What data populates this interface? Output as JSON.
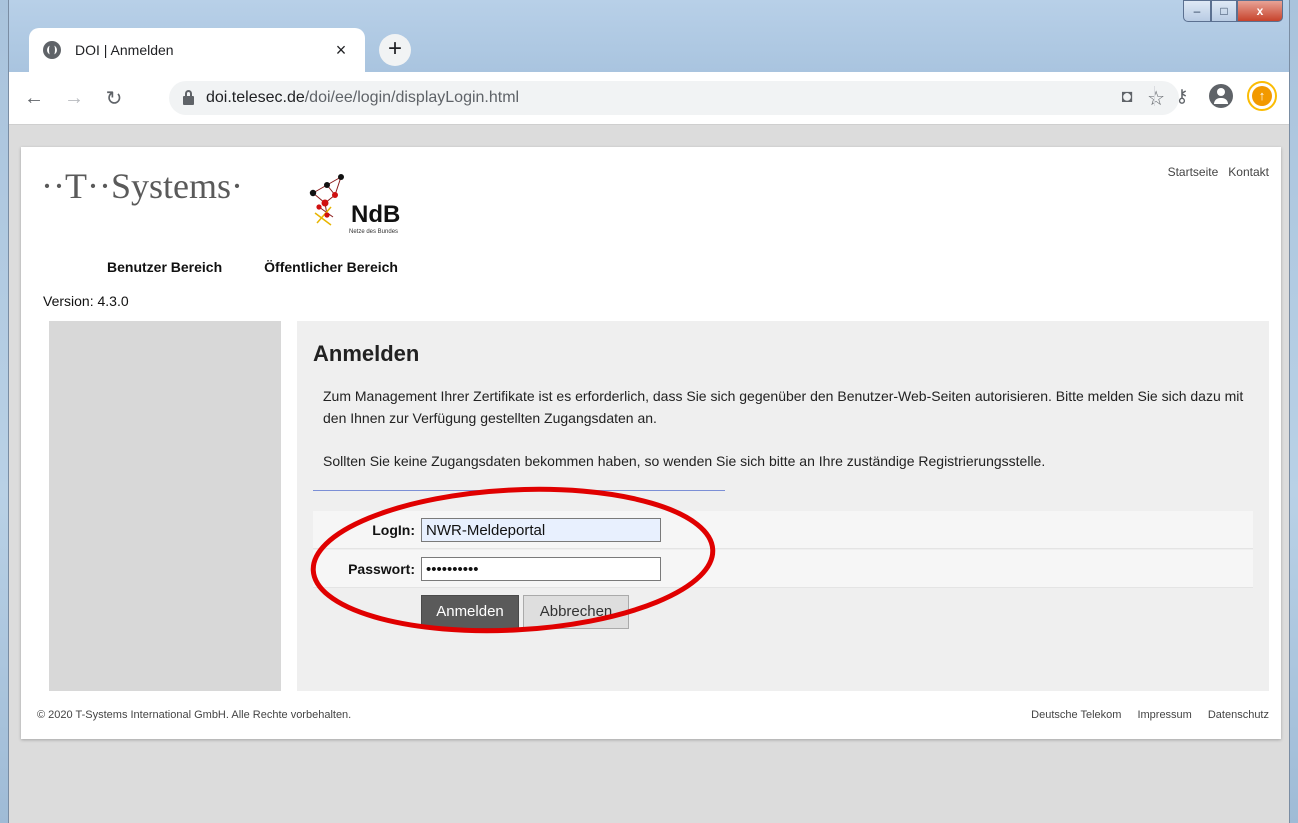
{
  "browser": {
    "tab_title": "DOI | Anmelden",
    "tab_close": "×",
    "new_tab": "+",
    "url_host": "doi.telesec.de",
    "url_path": "/doi/ee/login/displayLogin.html"
  },
  "window_controls": {
    "minimize": "‒",
    "maximize": "□",
    "close": "x"
  },
  "header": {
    "logo_text": "··T··Systems·",
    "partner_logo": "NdB",
    "partner_logo_subtitle": "Netze des Bundes",
    "top_links": [
      "Startseite",
      "Kontakt"
    ],
    "nav": [
      "Benutzer Bereich",
      "Öffentlicher Bereich"
    ],
    "version": "Version: 4.3.0"
  },
  "main": {
    "heading": "Anmelden",
    "intro": "Zum Management Ihrer Zertifikate ist es erforderlich, dass Sie sich gegenüber den Benutzer-Web-Seiten autorisieren. Bitte melden Sie sich dazu mit den Ihnen zur Verfügung gestellten Zugangsdaten an.",
    "note": "Sollten Sie keine Zugangsdaten bekommen haben, so wenden Sie sich bitte an Ihre zuständige Registrierungsstelle.",
    "form": {
      "login_label": "LogIn:",
      "login_value": "NWR-Meldeportal",
      "password_label": "Passwort:",
      "password_value": "••••••••••",
      "submit_label": "Anmelden",
      "cancel_label": "Abbrechen"
    }
  },
  "footer": {
    "copyright": "© 2020 T-Systems International GmbH. Alle Rechte vorbehalten.",
    "links": [
      "Deutsche Telekom",
      "Impressum",
      "Datenschutz"
    ]
  },
  "colors": {
    "telekom_magenta": "#e20074",
    "annotation_red": "#e00000",
    "primary_button": "#5a5a5a"
  }
}
